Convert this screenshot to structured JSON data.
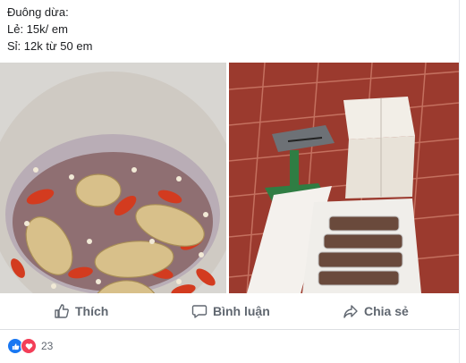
{
  "post": {
    "lines": [
      "Đuông dừa:",
      "Lẻ: 15k/ em",
      "Sỉ: 12k từ 50 em"
    ]
  },
  "photos": [
    {
      "icon": "larvae-in-chili-bowl-photo"
    },
    {
      "icon": "scale-and-foam-boxes-photo"
    }
  ],
  "actions": {
    "like_label": "Thích",
    "comment_label": "Bình luận",
    "share_label": "Chia sẻ"
  },
  "reactions": {
    "count": "23",
    "icons": [
      "like-reaction-icon",
      "love-reaction-icon"
    ]
  },
  "colors": {
    "action_text": "#606770",
    "like_blue": "#1877f2",
    "love_red": "#f33e58"
  }
}
